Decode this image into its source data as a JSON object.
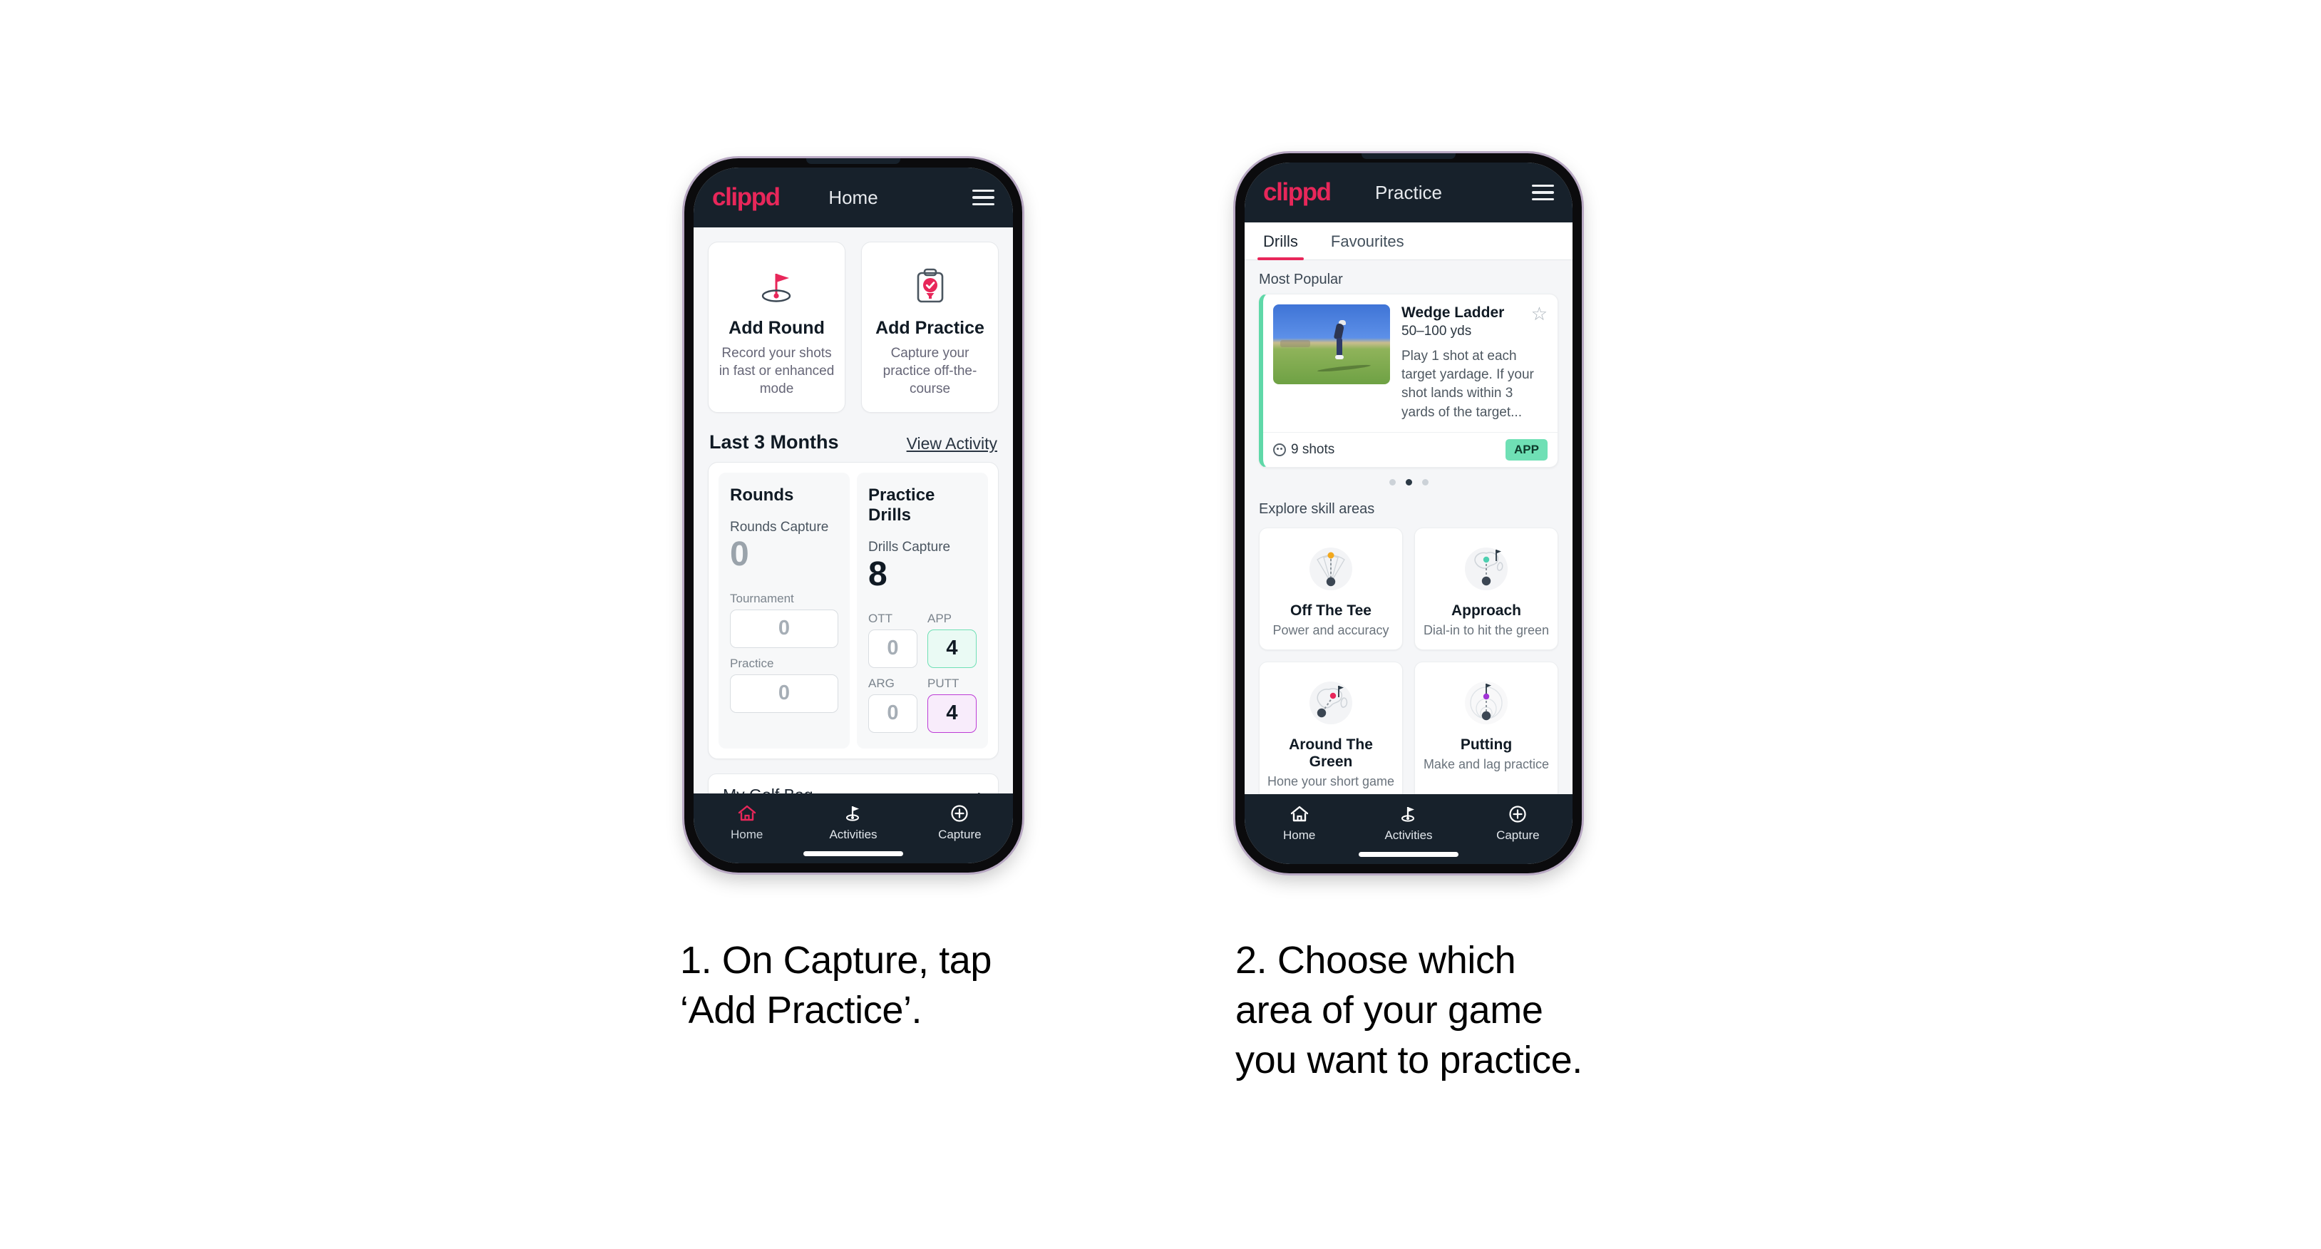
{
  "brand": {
    "logo_text": "clippd",
    "accent_pink": "#E8275A",
    "nav_dark": "#17212B"
  },
  "phone1": {
    "header": {
      "title": "Home",
      "menu_icon": "hamburger-menu-icon"
    },
    "quick_actions": [
      {
        "icon": "golf-flag-hole-icon",
        "title": "Add Round",
        "subtitle": "Record your shots in fast or enhanced mode"
      },
      {
        "icon": "clipboard-check-tee-icon",
        "title": "Add Practice",
        "subtitle": "Capture your practice off-the-course"
      }
    ],
    "section": {
      "title": "Last 3 Months",
      "link": "View Activity"
    },
    "rounds": {
      "col_title": "Rounds",
      "capture_label": "Rounds Capture",
      "capture_value": "0",
      "breakdown": [
        {
          "label": "Tournament",
          "value": "0",
          "state": "default"
        },
        {
          "label": "Practice",
          "value": "0",
          "state": "default"
        }
      ]
    },
    "drills": {
      "col_title": "Practice Drills",
      "capture_label": "Drills Capture",
      "capture_value": "8",
      "breakdown": [
        {
          "label": "OTT",
          "value": "0",
          "state": "default"
        },
        {
          "label": "APP",
          "value": "4",
          "state": "app"
        },
        {
          "label": "ARG",
          "value": "0",
          "state": "default"
        },
        {
          "label": "PUTT",
          "value": "4",
          "state": "putt"
        }
      ]
    },
    "golf_bag": {
      "label": "My Golf Bag",
      "chevron": "chevron-right-icon"
    },
    "nav": [
      {
        "label": "Home",
        "icon": "home-icon",
        "active": true
      },
      {
        "label": "Activities",
        "icon": "golf-flag-icon",
        "active": false
      },
      {
        "label": "Capture",
        "icon": "plus-circle-icon",
        "active": false
      }
    ]
  },
  "phone2": {
    "header": {
      "title": "Practice",
      "menu_icon": "hamburger-menu-icon"
    },
    "tabs": [
      {
        "label": "Drills",
        "active": true
      },
      {
        "label": "Favourites",
        "active": false
      }
    ],
    "most_popular_label": "Most Popular",
    "drill": {
      "name": "Wedge Ladder",
      "yardage": "50–100 yds",
      "description": "Play 1 shot at each target yardage. If your shot lands within 3 yards of the target...",
      "shots": "9 shots",
      "tag": "APP",
      "star_icon": "star-outline-icon",
      "accent": "#5FD8A8",
      "tag_color": "#6FE0B5"
    },
    "carousel_dots": {
      "count": 3,
      "active_index": 1
    },
    "explore_label": "Explore skill areas",
    "skill_areas": [
      {
        "name": "Off The Tee",
        "sub": "Power and accuracy",
        "icon": "tee-fan-icon",
        "dot_color": "#F2A81D"
      },
      {
        "name": "Approach",
        "sub": "Dial-in to hit the green",
        "icon": "approach-green-icon",
        "dot_color": "#4ECFB0"
      },
      {
        "name": "Around The Green",
        "sub": "Hone your short game",
        "icon": "around-green-icon",
        "dot_color": "#E8275A"
      },
      {
        "name": "Putting",
        "sub": "Make and lag practice",
        "icon": "putting-rings-icon",
        "dot_color": "#A234D6"
      }
    ],
    "nav": [
      {
        "label": "Home",
        "icon": "home-icon",
        "active": false
      },
      {
        "label": "Activities",
        "icon": "golf-flag-icon",
        "active": false
      },
      {
        "label": "Capture",
        "icon": "plus-circle-icon",
        "active": false
      }
    ]
  },
  "captions": {
    "step1": "1. On Capture, tap\n‘Add Practice’.",
    "step2": "2. Choose which\narea of your game\nyou want to practice."
  }
}
